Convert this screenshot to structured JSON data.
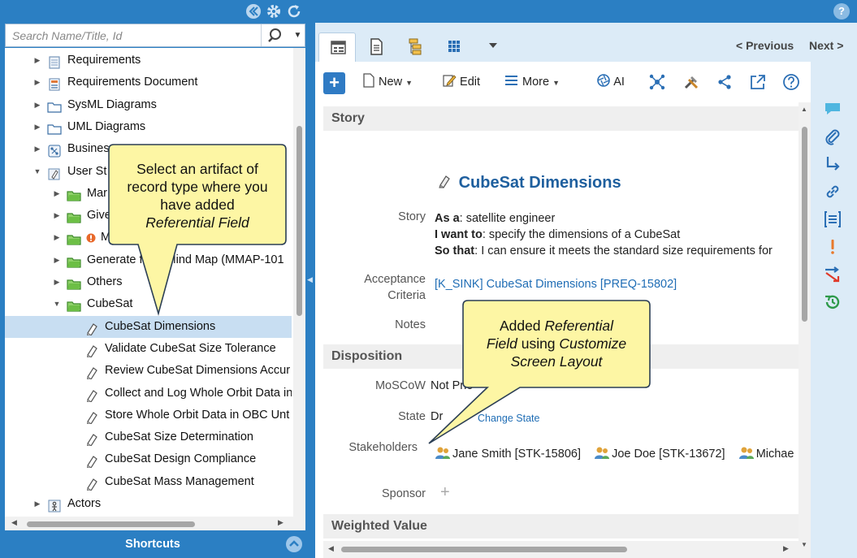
{
  "search": {
    "placeholder": "Search Name/Title, Id"
  },
  "tree": {
    "items": [
      {
        "label": "Requirements",
        "indent": 0,
        "expanded": false
      },
      {
        "label": "Requirements Document",
        "indent": 0,
        "expanded": false
      },
      {
        "label": "SysML Diagrams",
        "indent": 0,
        "expanded": false
      },
      {
        "label": "UML Diagrams",
        "indent": 0,
        "expanded": false
      },
      {
        "label": "Business",
        "indent": 0,
        "expanded": false
      },
      {
        "label": "User St",
        "indent": 0,
        "expanded": true
      },
      {
        "label": "Mar",
        "indent": 1,
        "expanded": false
      },
      {
        "label": "Give",
        "indent": 1,
        "expanded": false
      },
      {
        "label": "M",
        "indent": 1,
        "expanded": false
      },
      {
        "label": "Generate from Mind Map (MMAP-101",
        "indent": 1,
        "expanded": false
      },
      {
        "label": "Others",
        "indent": 1,
        "expanded": false
      },
      {
        "label": "CubeSat",
        "indent": 1,
        "expanded": true
      },
      {
        "label": "CubeSat Dimensions",
        "indent": 2,
        "selected": true
      },
      {
        "label": "Validate CubeSat Size Tolerance",
        "indent": 2
      },
      {
        "label": "Review CubeSat Dimensions Accur",
        "indent": 2
      },
      {
        "label": "Collect and Log Whole Orbit Data in",
        "indent": 2
      },
      {
        "label": "Store Whole Orbit Data in OBC Unt",
        "indent": 2
      },
      {
        "label": "CubeSat Size Determination",
        "indent": 2
      },
      {
        "label": "CubeSat Design Compliance",
        "indent": 2
      },
      {
        "label": "CubeSat Mass Management",
        "indent": 2
      },
      {
        "label": "Actors",
        "indent": 0,
        "expanded": false
      }
    ]
  },
  "shortcuts": {
    "label": "Shortcuts"
  },
  "nav": {
    "previous": "< Previous",
    "next": "Next >"
  },
  "toolbar": {
    "new_label": "New",
    "edit_label": "Edit",
    "more_label": "More",
    "ai_label": "AI"
  },
  "form": {
    "story_section": "Story",
    "title": "CubeSat Dimensions",
    "story_label": "Story",
    "story_as_a_key": "As a",
    "story_as_a": ": satellite engineer",
    "story_i_want_key": "I want to",
    "story_i_want": ": specify the dimensions of a CubeSat",
    "story_so_that_key": "So that",
    "story_so_that": ": I can ensure it meets the standard size requirements for",
    "acceptance_label_1": "Acceptance",
    "acceptance_label_2": "Criteria",
    "acceptance_value": "[K_SINK] CubeSat Dimensions [PREQ-15802]",
    "notes_label": "Notes",
    "disposition_section": "Disposition",
    "moscow_label": "MoSCoW",
    "moscow_value": "Not Prio",
    "state_label": "State",
    "state_value": "Dr",
    "change_state": "Change State",
    "stakeholders_label": "Stakeholders",
    "stakeholders": [
      "Jane Smith [STK-15806]",
      "Joe Doe [STK-13672]",
      "Michae"
    ],
    "sponsor_label": "Sponsor",
    "sponsor_add": "+",
    "weighted_section": "Weighted Value"
  },
  "callouts": {
    "left_line1": "Select an artifact of",
    "left_line2": "record type where you",
    "left_line3": "have added",
    "left_line4": "Referential Field",
    "right_line1_a": "Added ",
    "right_line1_b": "Referential",
    "right_line2_a": "Field",
    "right_line2_b": " using ",
    "right_line2_c": "Customize",
    "right_line3": "Screen Layout"
  },
  "colors": {
    "brand_blue": "#2b7fc3",
    "panel_light": "#dcebf7",
    "callout_fill": "#fdf6a4",
    "link": "#1f6db5",
    "selected_row": "#c8def2"
  }
}
